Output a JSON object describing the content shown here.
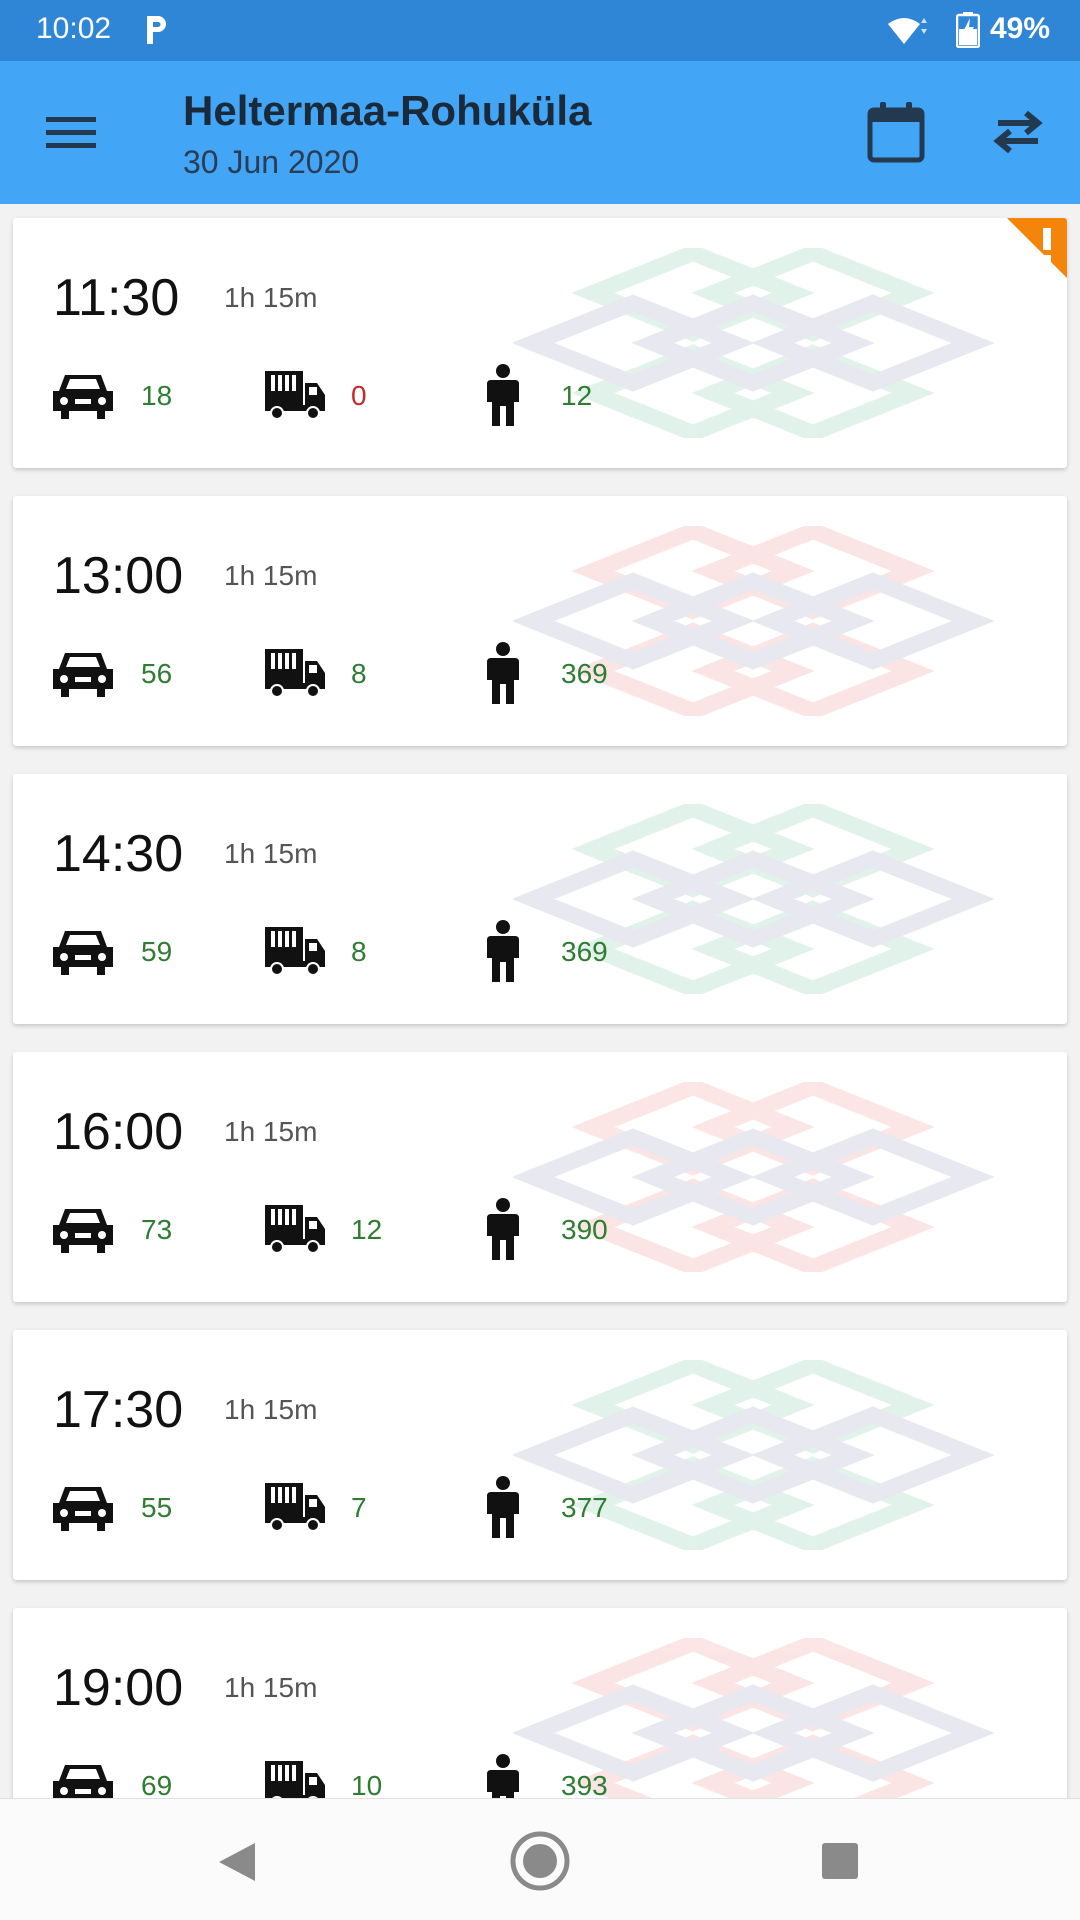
{
  "status_bar": {
    "time": "10:02",
    "battery": "49%"
  },
  "app_bar": {
    "title": "Heltermaa-Rohuküla",
    "date": "30 Jun 2020"
  },
  "colors": {
    "status_bar": "#2f86d6",
    "app_bar": "#42a5f5",
    "available": "#2e7d32",
    "unavailable": "#c62828",
    "warning": "#f5840b",
    "watermark_green": "#c9e8d9",
    "watermark_red": "#f7cfcf",
    "watermark_grey": "#d4d6e4"
  },
  "sailings": [
    {
      "time": "11:30",
      "duration": "1h 15m",
      "cars": "18",
      "trucks": "0",
      "passengers": "12",
      "warning": true,
      "theme": "green"
    },
    {
      "time": "13:00",
      "duration": "1h 15m",
      "cars": "56",
      "trucks": "8",
      "passengers": "369",
      "warning": false,
      "theme": "red"
    },
    {
      "time": "14:30",
      "duration": "1h 15m",
      "cars": "59",
      "trucks": "8",
      "passengers": "369",
      "warning": false,
      "theme": "green"
    },
    {
      "time": "16:00",
      "duration": "1h 15m",
      "cars": "73",
      "trucks": "12",
      "passengers": "390",
      "warning": false,
      "theme": "red"
    },
    {
      "time": "17:30",
      "duration": "1h 15m",
      "cars": "55",
      "trucks": "7",
      "passengers": "377",
      "warning": false,
      "theme": "green"
    },
    {
      "time": "19:00",
      "duration": "1h 15m",
      "cars": "69",
      "trucks": "10",
      "passengers": "393",
      "warning": false,
      "theme": "red"
    }
  ]
}
